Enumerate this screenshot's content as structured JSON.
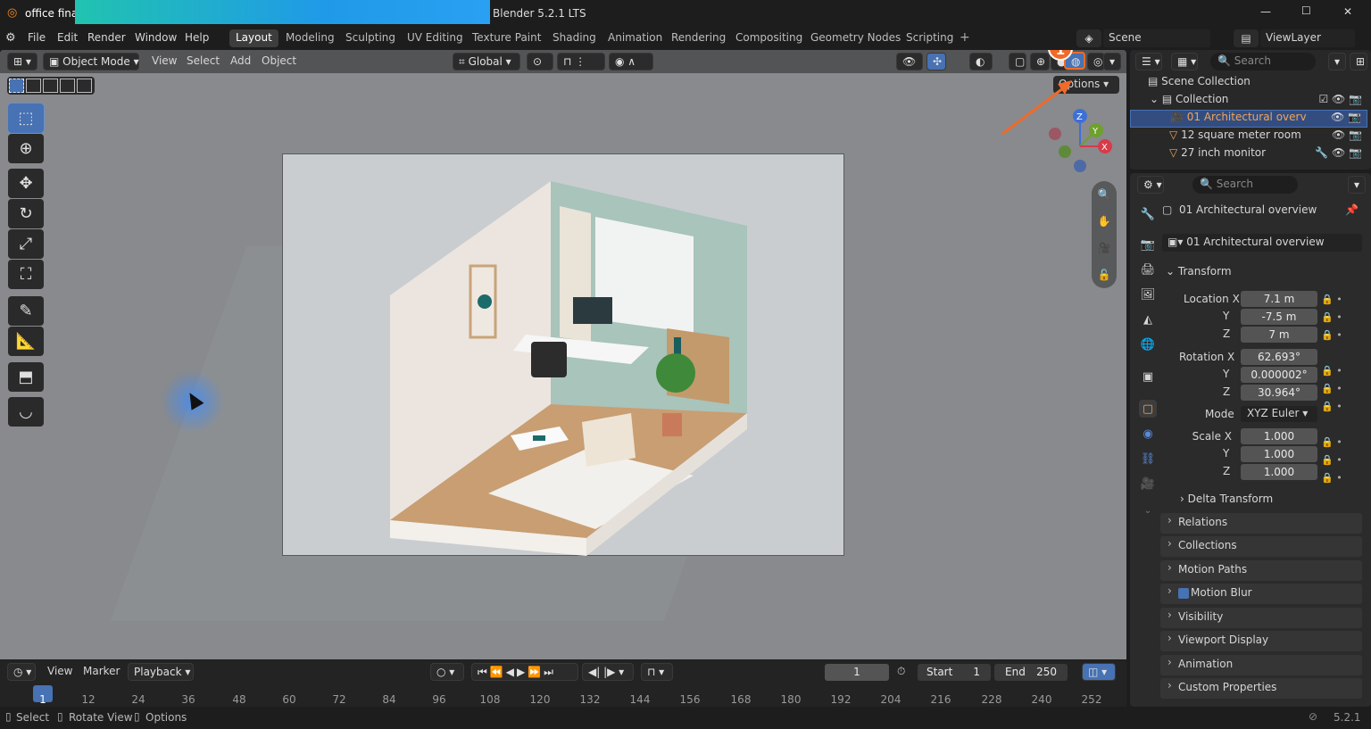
{
  "titlebar": {
    "file_label": "office fina",
    "app_title": "Blender 5.2.1 LTS",
    "minimize": "—",
    "maximize": "☐",
    "close": "✕"
  },
  "menu": {
    "file": "File",
    "edit": "Edit",
    "render": "Render",
    "window": "Window",
    "help": "Help"
  },
  "workspaces": [
    "Layout",
    "Modeling",
    "Sculpting",
    "UV Editing",
    "Texture Paint",
    "Shading",
    "Animation",
    "Rendering",
    "Compositing",
    "Geometry Nodes",
    "Scripting"
  ],
  "add_workspace": "+",
  "scene": {
    "name": "Scene",
    "viewlayer": "ViewLayer"
  },
  "viewport_header": {
    "mode": "Object Mode",
    "view": "View",
    "select": "Select",
    "add": "Add",
    "object": "Object",
    "orientation": "Global",
    "options": "Options"
  },
  "gizmo": {
    "x": "X",
    "y": "Y",
    "z": "Z"
  },
  "annotation": {
    "step": "1",
    "color": "#f06a2a"
  },
  "outliner": {
    "search_placeholder": "Search",
    "scene_collection": "Scene Collection",
    "collection": "Collection",
    "items": [
      "01 Architectural overv",
      "12 square meter room",
      "27 inch monitor"
    ]
  },
  "properties": {
    "search_placeholder": "Search",
    "object_name": "01 Architectural overview",
    "datablock_name": "01 Architectural overview",
    "transform_title": "Transform",
    "location_label": "Location X",
    "location": {
      "x": "7.1 m",
      "y": "-7.5 m",
      "z": "7 m"
    },
    "rotation_label": "Rotation X",
    "rotation": {
      "x": "62.693°",
      "y": "0.000002°",
      "z": "30.964°"
    },
    "mode_label": "Mode",
    "mode_value": "XYZ Euler",
    "scale_label": "Scale X",
    "scale": {
      "x": "1.000",
      "y": "1.000",
      "z": "1.000"
    },
    "axis_y": "Y",
    "axis_z": "Z",
    "delta_transform": "Delta Transform",
    "panels": [
      "Relations",
      "Collections",
      "Motion Paths",
      "Motion Blur",
      "Visibility",
      "Viewport Display",
      "Animation",
      "Custom Properties"
    ]
  },
  "timeline": {
    "view": "View",
    "marker": "Marker",
    "playback": "Playback",
    "current_frame": "1",
    "start_label": "Start",
    "start_value": "1",
    "end_label": "End",
    "end_value": "250",
    "ticks": [
      "1",
      "12",
      "24",
      "36",
      "48",
      "60",
      "72",
      "84",
      "96",
      "108",
      "120",
      "132",
      "144",
      "156",
      "168",
      "180",
      "192",
      "204",
      "216",
      "228",
      "240",
      "252"
    ]
  },
  "statusbar": {
    "select": "Select",
    "rotate_view": "Rotate View",
    "options": "Options",
    "version": "5.2.1"
  },
  "colors": {
    "accent": "#4772b3",
    "selected_row": "#334d80",
    "annotation": "#f06a2a",
    "wall_green": "#a8c4bb"
  }
}
